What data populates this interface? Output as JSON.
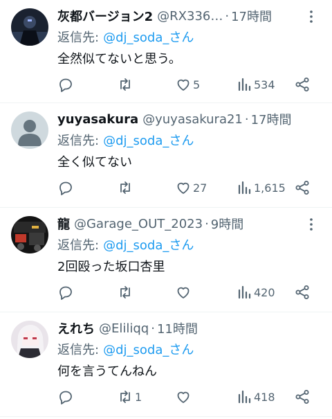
{
  "reply_prefix": "返信先:",
  "tweets": [
    {
      "display_name": "灰都バージョン2",
      "handle": "@RX336…",
      "time": "17時間",
      "reply_to": "@dj_soda_さん",
      "text": "全然似てないと思う。",
      "replies": "",
      "retweets": "",
      "likes": "5",
      "views": "534",
      "avatar_icon": "dark-character-avatar"
    },
    {
      "display_name": "yuyasakura",
      "handle": "@yuyasakura21",
      "time": "17時間",
      "reply_to": "@dj_soda_さん",
      "text": "全く似てない",
      "replies": "",
      "retweets": "",
      "likes": "27",
      "views": "1,615",
      "avatar_icon": "default-user-avatar"
    },
    {
      "display_name": "龍",
      "handle": "@Garage_OUT_2023",
      "time": "9時間",
      "reply_to": "@dj_soda_さん",
      "text": "2回殴った坂口杏里",
      "replies": "",
      "retweets": "",
      "likes": "",
      "views": "420",
      "avatar_icon": "garage-photo-avatar"
    },
    {
      "display_name": "えれち",
      "handle": "@Eliliqq",
      "time": "11時間",
      "reply_to": "@dj_soda_さん",
      "text": "何を言うてんねん",
      "replies": "",
      "retweets": "1",
      "likes": "",
      "views": "418",
      "avatar_icon": "anime-girl-avatar"
    }
  ],
  "colors": {
    "link": "#1d9bf0",
    "muted": "#536471",
    "text": "#0f1419"
  }
}
